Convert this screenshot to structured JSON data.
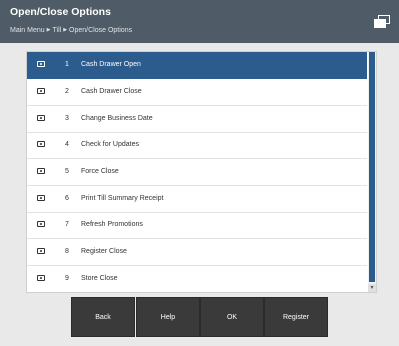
{
  "header": {
    "title": "Open/Close Options",
    "breadcrumb": [
      "Main Menu",
      "Till",
      "Open/Close Options"
    ],
    "window_icon": "windows-stack-icon"
  },
  "options": [
    {
      "num": "1",
      "label": "Cash Drawer Open",
      "selected": true
    },
    {
      "num": "2",
      "label": "Cash Drawer Close"
    },
    {
      "num": "3",
      "label": "Change Business Date"
    },
    {
      "num": "4",
      "label": "Check for Updates"
    },
    {
      "num": "5",
      "label": "Force Close"
    },
    {
      "num": "6",
      "label": "Print Till Summary Receipt"
    },
    {
      "num": "7",
      "label": "Refresh Promotions"
    },
    {
      "num": "8",
      "label": "Register Close"
    },
    {
      "num": "9",
      "label": "Store Close"
    }
  ],
  "buttons": {
    "back": "Back",
    "help": "Help",
    "ok": "OK",
    "register": "Register"
  },
  "colors": {
    "header_bg": "#4f5b66",
    "selected_row": "#2c5b8d",
    "button_bg": "#3a3a3a"
  }
}
